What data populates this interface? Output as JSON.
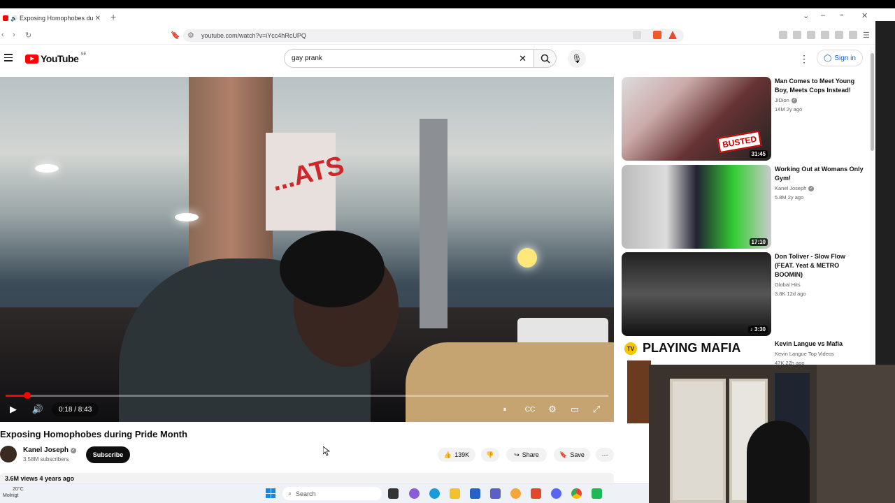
{
  "browser": {
    "tab_title": "Exposing Homophobes during",
    "url": "youtube.com/watch?v=iYcc4hRcUPQ"
  },
  "header": {
    "logo_text": "YouTube",
    "country_code": "SE",
    "search_value": "gay prank",
    "signin_label": "Sign in"
  },
  "player": {
    "time": "0:18 / 8:43",
    "progress_fraction": 0.036,
    "sign_text": "...ATS"
  },
  "video": {
    "title": "Exposing Homophobes during Pride Month",
    "channel": "Kanel Joseph",
    "subscribers": "3.58M subscribers",
    "subscribe_label": "Subscribe",
    "likes": "139K",
    "share_label": "Share",
    "save_label": "Save",
    "views_age": "3.6M views  4 years ago"
  },
  "recommendations": [
    {
      "title": "Man Comes to Meet Young Boy, Meets Cops Instead!",
      "channel": "JiDion",
      "meta": "14M  2y ago",
      "duration": "31:45",
      "thumb_text": "BUSTED"
    },
    {
      "title": "Working Out at Womans Only Gym!",
      "channel": "Kanel Joseph",
      "meta": "5.8M  2y ago",
      "duration": "17:10",
      "thumb_text": ""
    },
    {
      "title": "Don Toliver - Slow Flow (FEAT. Yeat & METRO BOOMIN)",
      "channel": "Global Hits",
      "meta": "3.8K  12d ago",
      "duration": "3:30",
      "thumb_text": ""
    },
    {
      "title": "Kevin Langue vs Mafia",
      "channel": "Kevin Langue Top Videos",
      "meta": "47K  22h ago",
      "duration": "",
      "thumb_text": "PLAYING MAFIA"
    }
  ],
  "taskbar": {
    "temperature": "20°C",
    "weather": "Molnigt",
    "search_placeholder": "Search"
  }
}
